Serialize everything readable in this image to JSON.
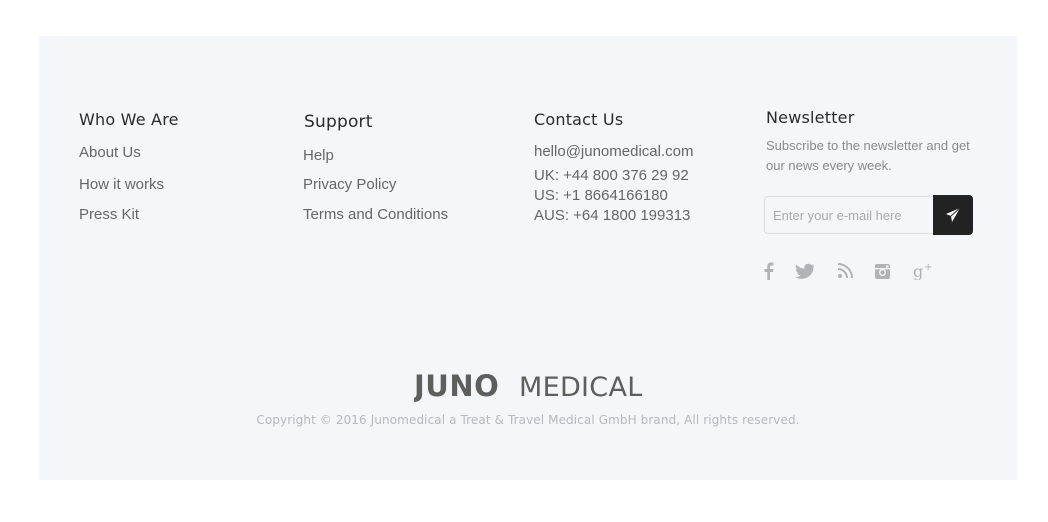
{
  "columns": {
    "who": {
      "heading": "Who We Are",
      "links": [
        "About Us",
        "How it works",
        "Press Kit"
      ]
    },
    "support": {
      "heading": "Support",
      "links": [
        "Help",
        "Privacy Policy",
        "Terms and Conditions"
      ]
    },
    "contact": {
      "heading": "Contact Us",
      "email": "hello@junomedical.com",
      "phones": [
        "UK: +44 800 376 29 92",
        "US: +1 8664166180",
        "AUS: +64 1800 199313"
      ]
    },
    "newsletter": {
      "heading": "Newsletter",
      "description": "Subscribe to the newsletter and get our news every week.",
      "input_placeholder": "Enter your e-mail here",
      "input_value": "",
      "submit_icon": "paper-plane-icon",
      "social_icons": [
        "facebook-icon",
        "twitter-icon",
        "rss-icon",
        "instagram-icon",
        "google-plus-icon"
      ]
    }
  },
  "brand": {
    "logo_text_bold": "JUNO",
    "logo_text_light": "MEDICAL",
    "copyright": "Copyright © 2016 Junomedical a Treat & Travel Medical GmbH brand, All rights reserved."
  },
  "colors": {
    "footer_bg": "#f5f6fa",
    "heading": "#2b2b2b",
    "link": "#666666",
    "muted": "#b6b8c0",
    "icon": "#b0b2b8",
    "button_bg": "#222222",
    "logo": "#5e5e5e"
  }
}
